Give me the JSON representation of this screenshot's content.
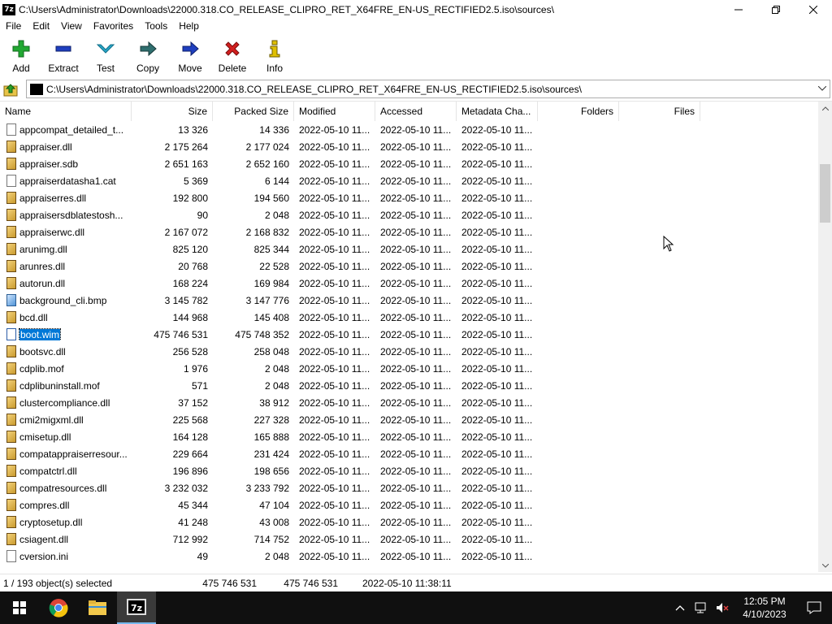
{
  "window": {
    "title": "C:\\Users\\Administrator\\Downloads\\22000.318.CO_RELEASE_CLIPRO_RET_X64FRE_EN-US_RECTIFIED2.5.iso\\sources\\",
    "app_icon_text": "7z"
  },
  "menu": [
    "File",
    "Edit",
    "View",
    "Favorites",
    "Tools",
    "Help"
  ],
  "toolbar": [
    {
      "label": "Add",
      "icon": "plus-icon",
      "color": "#22a832"
    },
    {
      "label": "Extract",
      "icon": "minus-icon",
      "color": "#1f3fbf"
    },
    {
      "label": "Test",
      "icon": "check-chevron-icon",
      "color": "#28a7c8"
    },
    {
      "label": "Copy",
      "icon": "copy-arrow-icon",
      "color": "#2f6f6f"
    },
    {
      "label": "Move",
      "icon": "move-arrow-icon",
      "color": "#1f3fbf"
    },
    {
      "label": "Delete",
      "icon": "x-icon",
      "color": "#d21f1f"
    },
    {
      "label": "Info",
      "icon": "info-icon",
      "color": "#e0c000"
    }
  ],
  "address": {
    "path": "C:\\Users\\Administrator\\Downloads\\22000.318.CO_RELEASE_CLIPRO_RET_X64FRE_EN-US_RECTIFIED2.5.iso\\sources\\"
  },
  "columns": [
    "Name",
    "Size",
    "Packed Size",
    "Modified",
    "Accessed",
    "Metadata Cha...",
    "Folders",
    "Files"
  ],
  "rows": [
    {
      "name": "appcompat_detailed_t...",
      "size": "13 326",
      "packed": "14 336",
      "modified": "2022-05-10 11...",
      "accessed": "2022-05-10 11...",
      "meta": "2022-05-10 11...",
      "icon": "cat",
      "selected": false
    },
    {
      "name": "appraiser.dll",
      "size": "2 175 264",
      "packed": "2 177 024",
      "modified": "2022-05-10 11...",
      "accessed": "2022-05-10 11...",
      "meta": "2022-05-10 11...",
      "icon": "dll",
      "selected": false
    },
    {
      "name": "appraiser.sdb",
      "size": "2 651 163",
      "packed": "2 652 160",
      "modified": "2022-05-10 11...",
      "accessed": "2022-05-10 11...",
      "meta": "2022-05-10 11...",
      "icon": "dll",
      "selected": false
    },
    {
      "name": "appraiserdatasha1.cat",
      "size": "5 369",
      "packed": "6 144",
      "modified": "2022-05-10 11...",
      "accessed": "2022-05-10 11...",
      "meta": "2022-05-10 11...",
      "icon": "cat",
      "selected": false
    },
    {
      "name": "appraiserres.dll",
      "size": "192 800",
      "packed": "194 560",
      "modified": "2022-05-10 11...",
      "accessed": "2022-05-10 11...",
      "meta": "2022-05-10 11...",
      "icon": "dll",
      "selected": false
    },
    {
      "name": "appraisersdblatestosh...",
      "size": "90",
      "packed": "2 048",
      "modified": "2022-05-10 11...",
      "accessed": "2022-05-10 11...",
      "meta": "2022-05-10 11...",
      "icon": "dll",
      "selected": false
    },
    {
      "name": "appraiserwc.dll",
      "size": "2 167 072",
      "packed": "2 168 832",
      "modified": "2022-05-10 11...",
      "accessed": "2022-05-10 11...",
      "meta": "2022-05-10 11...",
      "icon": "dll",
      "selected": false
    },
    {
      "name": "arunimg.dll",
      "size": "825 120",
      "packed": "825 344",
      "modified": "2022-05-10 11...",
      "accessed": "2022-05-10 11...",
      "meta": "2022-05-10 11...",
      "icon": "dll",
      "selected": false
    },
    {
      "name": "arunres.dll",
      "size": "20 768",
      "packed": "22 528",
      "modified": "2022-05-10 11...",
      "accessed": "2022-05-10 11...",
      "meta": "2022-05-10 11...",
      "icon": "dll",
      "selected": false
    },
    {
      "name": "autorun.dll",
      "size": "168 224",
      "packed": "169 984",
      "modified": "2022-05-10 11...",
      "accessed": "2022-05-10 11...",
      "meta": "2022-05-10 11...",
      "icon": "dll",
      "selected": false
    },
    {
      "name": "background_cli.bmp",
      "size": "3 145 782",
      "packed": "3 147 776",
      "modified": "2022-05-10 11...",
      "accessed": "2022-05-10 11...",
      "meta": "2022-05-10 11...",
      "icon": "img",
      "selected": false
    },
    {
      "name": "bcd.dll",
      "size": "144 968",
      "packed": "145 408",
      "modified": "2022-05-10 11...",
      "accessed": "2022-05-10 11...",
      "meta": "2022-05-10 11...",
      "icon": "dll",
      "selected": false
    },
    {
      "name": "boot.wim",
      "size": "475 746 531",
      "packed": "475 748 352",
      "modified": "2022-05-10 11...",
      "accessed": "2022-05-10 11...",
      "meta": "2022-05-10 11...",
      "icon": "wim",
      "selected": true
    },
    {
      "name": "bootsvc.dll",
      "size": "256 528",
      "packed": "258 048",
      "modified": "2022-05-10 11...",
      "accessed": "2022-05-10 11...",
      "meta": "2022-05-10 11...",
      "icon": "dll",
      "selected": false
    },
    {
      "name": "cdplib.mof",
      "size": "1 976",
      "packed": "2 048",
      "modified": "2022-05-10 11...",
      "accessed": "2022-05-10 11...",
      "meta": "2022-05-10 11...",
      "icon": "dll",
      "selected": false
    },
    {
      "name": "cdplibuninstall.mof",
      "size": "571",
      "packed": "2 048",
      "modified": "2022-05-10 11...",
      "accessed": "2022-05-10 11...",
      "meta": "2022-05-10 11...",
      "icon": "dll",
      "selected": false
    },
    {
      "name": "clustercompliance.dll",
      "size": "37 152",
      "packed": "38 912",
      "modified": "2022-05-10 11...",
      "accessed": "2022-05-10 11...",
      "meta": "2022-05-10 11...",
      "icon": "dll",
      "selected": false
    },
    {
      "name": "cmi2migxml.dll",
      "size": "225 568",
      "packed": "227 328",
      "modified": "2022-05-10 11...",
      "accessed": "2022-05-10 11...",
      "meta": "2022-05-10 11...",
      "icon": "dll",
      "selected": false
    },
    {
      "name": "cmisetup.dll",
      "size": "164 128",
      "packed": "165 888",
      "modified": "2022-05-10 11...",
      "accessed": "2022-05-10 11...",
      "meta": "2022-05-10 11...",
      "icon": "dll",
      "selected": false
    },
    {
      "name": "compatappraiserresour...",
      "size": "229 664",
      "packed": "231 424",
      "modified": "2022-05-10 11...",
      "accessed": "2022-05-10 11...",
      "meta": "2022-05-10 11...",
      "icon": "dll",
      "selected": false
    },
    {
      "name": "compatctrl.dll",
      "size": "196 896",
      "packed": "198 656",
      "modified": "2022-05-10 11...",
      "accessed": "2022-05-10 11...",
      "meta": "2022-05-10 11...",
      "icon": "dll",
      "selected": false
    },
    {
      "name": "compatresources.dll",
      "size": "3 232 032",
      "packed": "3 233 792",
      "modified": "2022-05-10 11...",
      "accessed": "2022-05-10 11...",
      "meta": "2022-05-10 11...",
      "icon": "dll",
      "selected": false
    },
    {
      "name": "compres.dll",
      "size": "45 344",
      "packed": "47 104",
      "modified": "2022-05-10 11...",
      "accessed": "2022-05-10 11...",
      "meta": "2022-05-10 11...",
      "icon": "dll",
      "selected": false
    },
    {
      "name": "cryptosetup.dll",
      "size": "41 248",
      "packed": "43 008",
      "modified": "2022-05-10 11...",
      "accessed": "2022-05-10 11...",
      "meta": "2022-05-10 11...",
      "icon": "dll",
      "selected": false
    },
    {
      "name": "csiagent.dll",
      "size": "712 992",
      "packed": "714 752",
      "modified": "2022-05-10 11...",
      "accessed": "2022-05-10 11...",
      "meta": "2022-05-10 11...",
      "icon": "dll",
      "selected": false
    },
    {
      "name": "cversion.ini",
      "size": "49",
      "packed": "2 048",
      "modified": "2022-05-10 11...",
      "accessed": "2022-05-10 11...",
      "meta": "2022-05-10 11...",
      "icon": "ini",
      "selected": false
    }
  ],
  "status": {
    "selection": "1 / 193 object(s) selected",
    "size": "475 746 531",
    "packed": "475 746 531",
    "modified": "2022-05-10 11:38:11"
  },
  "taskbar": {
    "time": "12:05 PM",
    "date": "4/10/2023"
  }
}
